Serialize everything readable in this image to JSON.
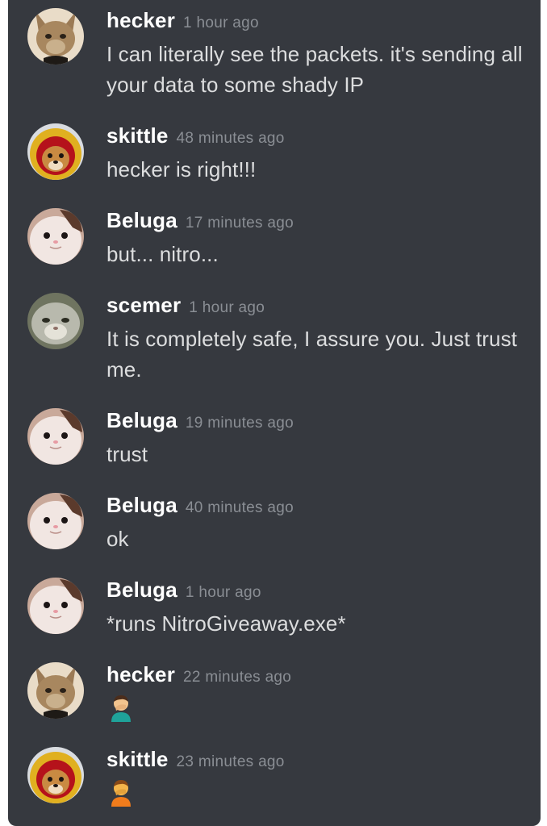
{
  "messages": [
    {
      "author": "hecker",
      "time": "1 hour ago",
      "text": "I can literally see the packets. it's sending all your data to some shady IP",
      "avatar": "cat-avatar"
    },
    {
      "author": "skittle",
      "time": "48 minutes ago",
      "text": "hecker is right!!!",
      "avatar": "dog-helmet-avatar"
    },
    {
      "author": "Beluga",
      "time": "17 minutes ago",
      "text": "but... nitro...",
      "avatar": "beluga-cat-avatar"
    },
    {
      "author": "scemer",
      "time": "1 hour ago",
      "text": "It is completely safe, I assure you. Just trust me.",
      "avatar": "grey-cat-avatar"
    },
    {
      "author": "Beluga",
      "time": "19 minutes ago",
      "text": "trust",
      "avatar": "beluga-cat-avatar"
    },
    {
      "author": "Beluga",
      "time": "40 minutes ago",
      "text": "ok",
      "avatar": "beluga-cat-avatar"
    },
    {
      "author": "Beluga",
      "time": "1 hour ago",
      "text": "*runs NitroGiveaway.exe*",
      "avatar": "beluga-cat-avatar"
    },
    {
      "author": "hecker",
      "time": "22 minutes ago",
      "emoji": "man-facepalming-emoji",
      "avatar": "cat-avatar"
    },
    {
      "author": "skittle",
      "time": "23 minutes ago",
      "emoji": "person-facepalming-emoji",
      "avatar": "dog-helmet-avatar"
    }
  ]
}
